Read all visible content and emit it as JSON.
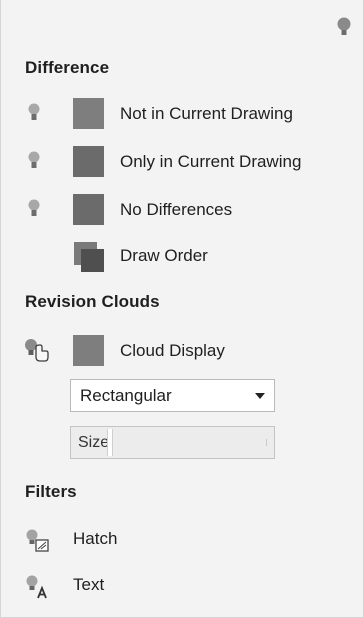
{
  "panel": {
    "sections": {
      "difference": "Difference",
      "revision_clouds": "Revision Clouds",
      "filters": "Filters"
    },
    "difference_items": [
      {
        "label": "Not in Current Drawing",
        "icon": "lightbulb-icon"
      },
      {
        "label": "Only in Current Drawing",
        "icon": "lightbulb-icon"
      },
      {
        "label": "No Differences",
        "icon": "lightbulb-icon"
      },
      {
        "label": "Draw Order",
        "icon": "draw-order-icon"
      }
    ],
    "cloud_display": {
      "label": "Cloud Display",
      "icon": "lightbulb-pointer-icon"
    },
    "shape_dropdown": {
      "selected": "Rectangular"
    },
    "size_slider": {
      "label": "Size"
    },
    "filter_items": [
      {
        "label": "Hatch",
        "icon": "hatch-filter-icon"
      },
      {
        "label": "Text",
        "icon": "text-filter-icon"
      }
    ]
  }
}
